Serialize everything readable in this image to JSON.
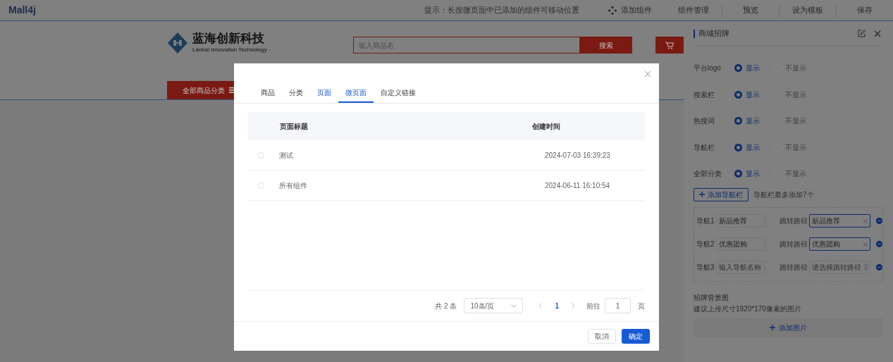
{
  "top_bar": {
    "logo": "Mall4j",
    "hint": "提示：长按微页面中已添加的组件可移动位置",
    "actions": [
      {
        "label": "添加组件",
        "kind": "icon"
      },
      {
        "label": "组件管理",
        "kind": "text"
      },
      {
        "label": "预览",
        "kind": "text"
      },
      {
        "label": "设为模板",
        "kind": "text"
      },
      {
        "label": "保存",
        "kind": "text"
      }
    ]
  },
  "store_header": {
    "brand_name": "蓝海创新科技",
    "brand_subtitle": "Lanhai Innovation Technology",
    "search_placeholder": "输入商品名",
    "search_button": "搜索",
    "category_button": "全部商品分类"
  },
  "right_panel": {
    "title": "商城招牌",
    "toggles": [
      {
        "label": "平台logo",
        "options": [
          {
            "label": "显示",
            "selected": true
          },
          {
            "label": "不显示",
            "selected": false
          }
        ]
      },
      {
        "label": "搜索栏",
        "options": [
          {
            "label": "显示",
            "selected": true
          },
          {
            "label": "不显示",
            "selected": false
          }
        ]
      },
      {
        "label": "热搜词",
        "options": [
          {
            "label": "显示",
            "selected": true
          },
          {
            "label": "不显示",
            "selected": false
          }
        ]
      },
      {
        "label": "导航栏",
        "options": [
          {
            "label": "显示",
            "selected": true
          },
          {
            "label": "不显示",
            "selected": false
          }
        ]
      },
      {
        "label": "全部分类",
        "options": [
          {
            "label": "显示",
            "selected": true
          },
          {
            "label": "不显示",
            "selected": false
          }
        ]
      }
    ],
    "add_nav_button": "添加导航栏",
    "add_nav_hint": "导航栏最多添加7个",
    "nav_items": [
      {
        "label": "导航1",
        "name_value": "新品推荐",
        "path_label": "跳转路径",
        "path_value": "新品推荐"
      },
      {
        "label": "导航2",
        "name_value": "优惠团购",
        "path_label": "跳转路径",
        "path_value": "优惠团购"
      },
      {
        "label": "导航3",
        "name_placeholder": "输入导航名称",
        "path_label": "跳转路径",
        "path_placeholder": "请选择跳转路径"
      }
    ],
    "background": {
      "title": "招牌背景图",
      "hint": "建议上传尺寸1920*170像素的图片",
      "add_button": "添加图片"
    }
  },
  "modal": {
    "tabs": [
      {
        "label": "商品",
        "selected": false,
        "hovered": false
      },
      {
        "label": "分类",
        "selected": false,
        "hovered": false
      },
      {
        "label": "页面",
        "selected": false,
        "hovered": true
      },
      {
        "label": "微页面",
        "selected": true,
        "hovered": false
      },
      {
        "label": "自定义链接",
        "selected": false,
        "hovered": false
      }
    ],
    "table": {
      "columns": [
        "页面标题",
        "创建时间"
      ],
      "rows": [
        {
          "selected": false,
          "title": "测试",
          "created": "2024-07-03 16:39:23"
        },
        {
          "selected": false,
          "title": "所有组件",
          "created": "2024-06-11 16:10:54"
        }
      ]
    },
    "pagination": {
      "total": "共 2 条",
      "page_size": "10条/页",
      "pages": [
        {
          "label": "1",
          "selected": true
        }
      ],
      "goto_label": "前往",
      "goto_value": "1",
      "goto_suffix": "页"
    },
    "buttons": {
      "cancel": "取消",
      "confirm": "确定"
    }
  }
}
